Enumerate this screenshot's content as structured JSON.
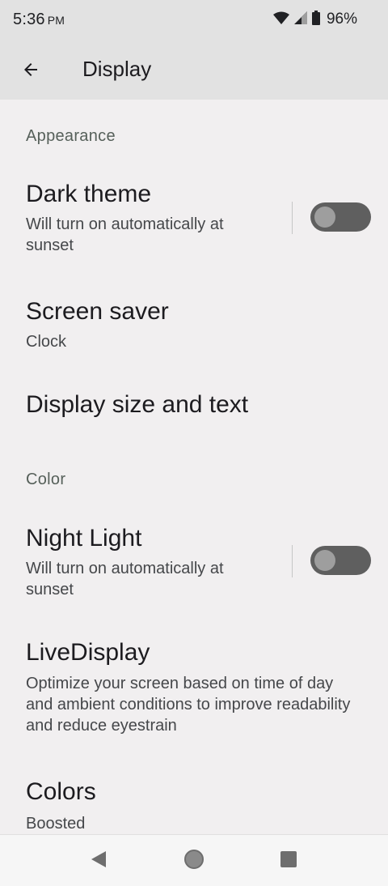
{
  "status_bar": {
    "time": "5:36",
    "ampm": "PM",
    "battery_percent": "96%",
    "icons": [
      "wifi-icon",
      "cell-signal-icon",
      "battery-icon"
    ]
  },
  "app_bar": {
    "title": "Display",
    "back_icon": "arrow-back-icon"
  },
  "sections": {
    "appearance": {
      "label": "Appearance",
      "dark_theme": {
        "title": "Dark theme",
        "summary": "Will turn on automatically at sunset",
        "enabled": false
      },
      "screen_saver": {
        "title": "Screen saver",
        "summary": "Clock"
      },
      "display_size": {
        "title": "Display size and text"
      }
    },
    "color": {
      "label": "Color",
      "night_light": {
        "title": "Night Light",
        "summary": "Will turn on automatically at sunset",
        "enabled": false
      },
      "live_display": {
        "title": "LiveDisplay",
        "summary": "Optimize your screen based on time of day and ambient conditions to improve readability and reduce eyestrain"
      },
      "colors": {
        "title": "Colors",
        "summary": "Boosted"
      }
    }
  },
  "nav_bar": {
    "buttons": [
      "back-triangle-icon",
      "home-circle-icon",
      "recents-square-icon"
    ]
  }
}
